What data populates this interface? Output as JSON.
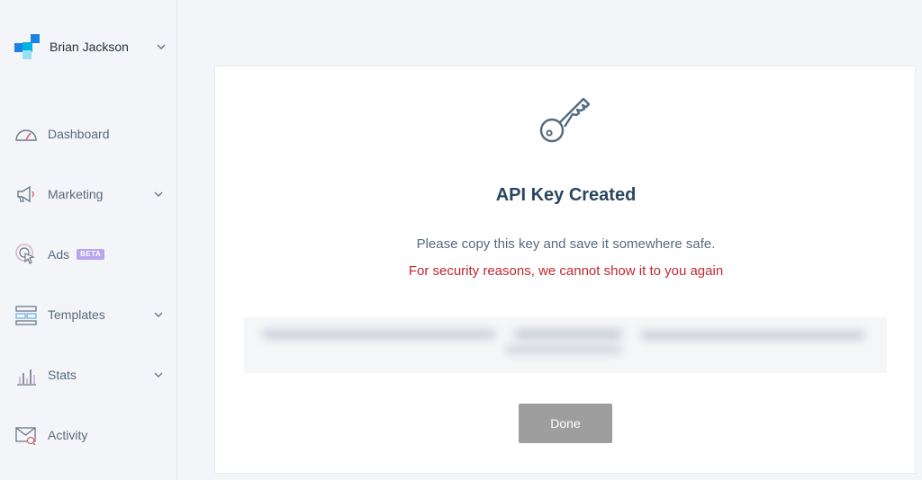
{
  "account": {
    "name": "Brian Jackson",
    "logo_colors": [
      "#1a82e2",
      "#00b3e3",
      "#99e1f4",
      "#1a82e2"
    ]
  },
  "sidebar": {
    "items": [
      {
        "label": "Dashboard",
        "icon": "gauge-icon",
        "has_chevron": false
      },
      {
        "label": "Marketing",
        "icon": "megaphone-icon",
        "has_chevron": true
      },
      {
        "label": "Ads",
        "icon": "cursor-target-icon",
        "has_chevron": false,
        "badge": "BETA"
      },
      {
        "label": "Templates",
        "icon": "templates-icon",
        "has_chevron": true
      },
      {
        "label": "Stats",
        "icon": "bar-chart-icon",
        "has_chevron": true
      },
      {
        "label": "Activity",
        "icon": "envelope-search-icon",
        "has_chevron": false
      }
    ]
  },
  "dialog": {
    "icon": "key-icon",
    "title": "API Key Created",
    "message": "Please copy this key and save it somewhere safe.",
    "warning": "For security reasons, we cannot show it to you again",
    "done_label": "Done"
  },
  "colors": {
    "warning": "#c0282d",
    "title": "#294661",
    "button_disabled": "#9e9e9e",
    "badge": "#b8a5f0"
  }
}
